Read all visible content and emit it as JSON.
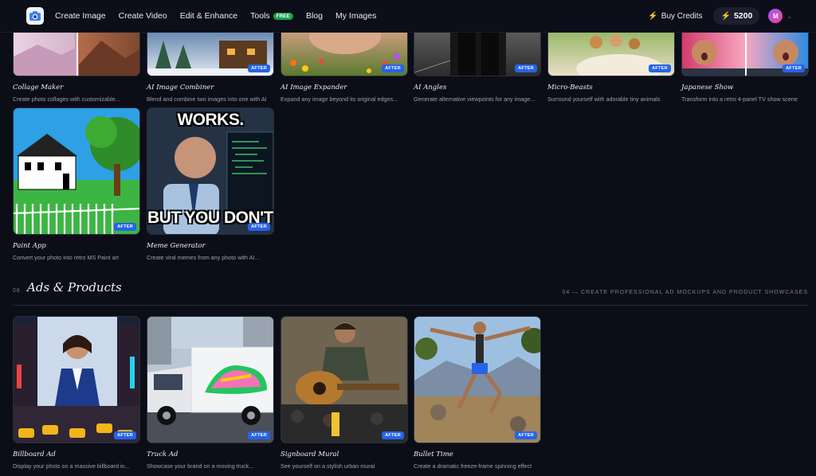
{
  "nav": {
    "links": [
      "Create Image",
      "Create Video",
      "Edit & Enhance",
      "Tools",
      "Blog",
      "My Images"
    ],
    "free_badge": "FREE",
    "buy_credits": "Buy Credits",
    "credits": "5200",
    "avatar_initial": "M"
  },
  "after_label": "AFTER",
  "row1": [
    {
      "title": "Collage Maker",
      "desc": "Create photo collages with customizable..."
    },
    {
      "title": "AI Image Combiner",
      "desc": "Blend and combine two images into one with AI"
    },
    {
      "title": "AI Image Expander",
      "desc": "Expand any image beyond its original edges..."
    },
    {
      "title": "AI Angles",
      "desc": "Generate alternative viewpoints for any image..."
    },
    {
      "title": "Micro-Beasts",
      "desc": "Surround yourself with adorable tiny animals"
    },
    {
      "title": "Japanese Show",
      "desc": "Transform into a retro 4-panel TV show scene"
    }
  ],
  "row2": [
    {
      "title": "Paint App",
      "desc": "Convert your photo into retro MS Paint art"
    },
    {
      "title": "Meme Generator",
      "desc": "Create viral memes from any photo with AI...",
      "top_text": "WORKS.",
      "bottom_text": "BUT YOU DON'T"
    }
  ],
  "section": {
    "number": "06",
    "title": "Ads & Products",
    "subtitle": "04 — CREATE PROFESSIONAL AD MOCKUPS AND PRODUCT SHOWCASES"
  },
  "row3": [
    {
      "title": "Billboard Ad",
      "desc": "Display your photo on a massive billboard in..."
    },
    {
      "title": "Truck Ad",
      "desc": "Showcase your brand on a moving truck..."
    },
    {
      "title": "Signboard Mural",
      "desc": "See yourself on a stylish urban mural"
    },
    {
      "title": "Bullet Time",
      "desc": "Create a dramatic freeze-frame spinning effect"
    }
  ]
}
